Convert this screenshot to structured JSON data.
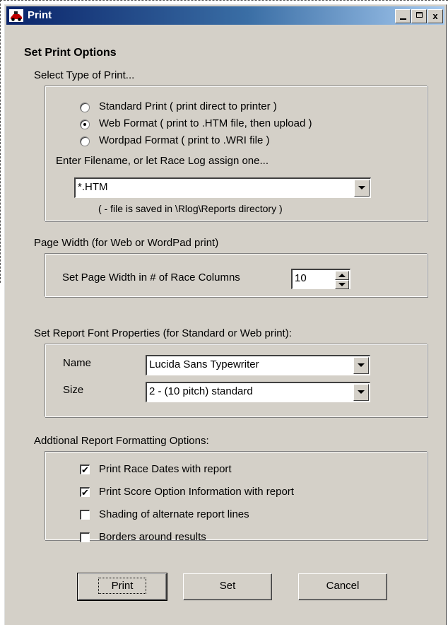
{
  "window": {
    "title": "Print",
    "minimize_label": "_",
    "close_label": "x"
  },
  "heading": "Set Print Options",
  "print_type": {
    "label": "Select Type of Print...",
    "options": [
      {
        "label": "Standard Print  ( print direct to printer )",
        "selected": false
      },
      {
        "label": "Web Format  ( print to  .HTM file, then upload )",
        "selected": true
      },
      {
        "label": "Wordpad Format  ( print to  .WRI file )",
        "selected": false
      }
    ],
    "filename_label": "Enter Filename, or let Race Log assign one...",
    "filename_value": "*.HTM",
    "filename_note": "( - file is saved in \\Rlog\\Reports directory )"
  },
  "page_width": {
    "label": "Page Width  (for Web or WordPad print)",
    "field_label": "Set Page Width in # of Race Columns",
    "value": "10"
  },
  "font_props": {
    "label": "Set Report Font Properties  (for Standard or Web print):",
    "name_label": "Name",
    "name_value": "Lucida Sans Typewriter",
    "size_label": "Size",
    "size_value": "2 - (10 pitch) standard"
  },
  "formatting": {
    "label": "Addtional Report Formatting Options:",
    "options": [
      {
        "label": "Print Race Dates with report",
        "checked": true
      },
      {
        "label": "Print Score Option Information with report",
        "checked": true
      },
      {
        "label": "Shading of alternate report lines",
        "checked": false
      },
      {
        "label": "Borders around results",
        "checked": false
      }
    ]
  },
  "buttons": {
    "print": "Print",
    "set": "Set",
    "cancel": "Cancel"
  },
  "check_mark": "✔"
}
